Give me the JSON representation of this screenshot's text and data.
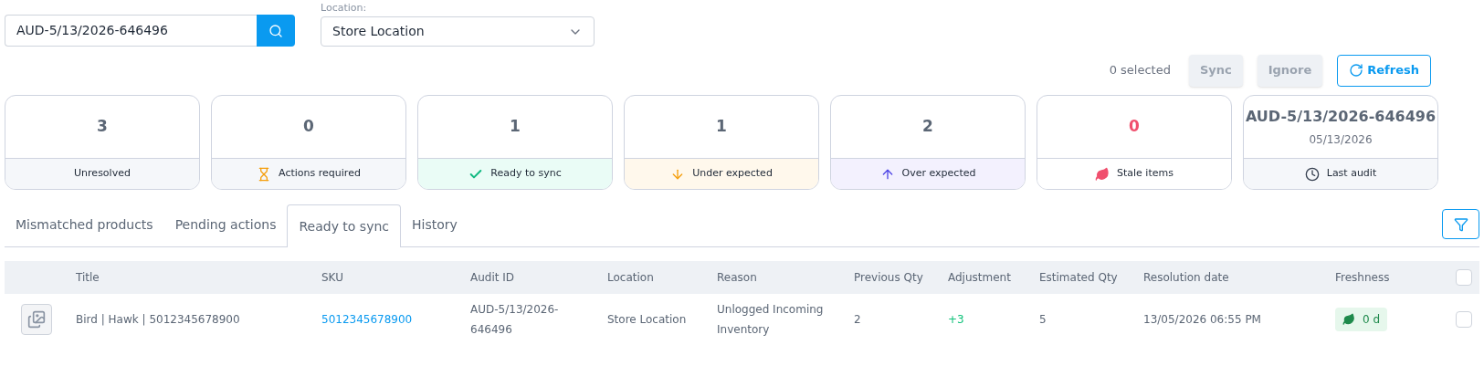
{
  "search": {
    "value": "AUD-5/13/2026-646496"
  },
  "location": {
    "label": "Location:",
    "value": "Store Location"
  },
  "toolbar": {
    "selected_count": "0 selected",
    "buttons": [
      {
        "label": "Sync",
        "kind": "plain",
        "disabled": true
      },
      {
        "label": "Ignore",
        "kind": "plain",
        "disabled": true
      },
      {
        "label": "Refresh",
        "kind": "refresh",
        "disabled": false
      }
    ]
  },
  "cards": [
    {
      "value": "3",
      "label": "Unresolved",
      "kind": "none",
      "color": "#f5f7fa",
      "alert": false
    },
    {
      "value": "0",
      "label": "Actions required",
      "kind": "hourglass",
      "color": "#f5f7fa",
      "alert": false
    },
    {
      "value": "1",
      "label": "Ready to sync",
      "kind": "check",
      "color": "#eafcf6",
      "alert": false
    },
    {
      "value": "1",
      "label": "Under expected",
      "kind": "down",
      "color": "#fff8ec",
      "alert": false
    },
    {
      "value": "2",
      "label": "Over expected",
      "kind": "up",
      "color": "#f3f1fe",
      "alert": false
    },
    {
      "value": "0",
      "label": "Stale items",
      "kind": "leaf",
      "color": "#ffffff",
      "alert": true
    },
    {
      "value": "AUD-5/13/2026-646496",
      "subvalue": "05/13/2026",
      "label": "Last audit",
      "kind": "clock",
      "color": "#f5f7fa",
      "alert": false
    }
  ],
  "tabs": [
    {
      "label": "Mismatched products",
      "selected": false
    },
    {
      "label": "Pending actions",
      "selected": false
    },
    {
      "label": "Ready to sync",
      "selected": true
    },
    {
      "label": "History",
      "selected": false
    }
  ],
  "table": {
    "columns": [
      "Title",
      "SKU",
      "Audit ID",
      "Location",
      "Reason",
      "Previous Qty",
      "Adjustment",
      "Estimated Qty",
      "Resolution date",
      "Freshness"
    ],
    "all_selected": false,
    "rows": [
      {
        "title": "Bird | Hawk | 5012345678900",
        "sku": "5012345678900",
        "audit_id": "AUD-5/13/2026-646496",
        "location": "Store Location",
        "reason": "Unlogged Incoming Inventory",
        "previous_qty": "2",
        "adjustment": "+3",
        "estimated_qty": "5",
        "resolution_date": "13/05/2026 06:55 PM",
        "freshness": "0 d",
        "selected": false
      }
    ]
  }
}
